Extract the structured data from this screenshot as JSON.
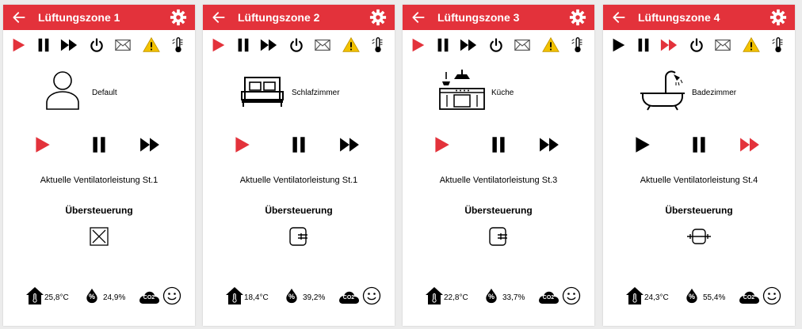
{
  "colors": {
    "accent": "#e3323b",
    "active": "#e3323b",
    "inactive": "#000000",
    "warning": "#f2c200"
  },
  "override_heading": "Übersteuerung",
  "panels": [
    {
      "title": "Lüftungszone 1",
      "room": "Default",
      "room_icon": "person-icon",
      "status": "Aktuelle Ventilatorleistung St.1",
      "active_mode": "play",
      "override_icon": "disabled-icon",
      "temperature": "25,8°C",
      "humidity": "24,9%"
    },
    {
      "title": "Lüftungszone 2",
      "room": "Schlafzimmer",
      "room_icon": "bed-icon",
      "status": "Aktuelle Ventilatorleistung St.1",
      "active_mode": "play",
      "override_icon": "fan-in-icon",
      "temperature": "18,4°C",
      "humidity": "39,2%"
    },
    {
      "title": "Lüftungszone 3",
      "room": "Küche",
      "room_icon": "kitchen-icon",
      "status": "Aktuelle Ventilatorleistung St.3",
      "active_mode": "play",
      "override_icon": "fan-in-icon",
      "temperature": "22,8°C",
      "humidity": "33,7%"
    },
    {
      "title": "Lüftungszone 4",
      "room": "Badezimmer",
      "room_icon": "bathtub-icon",
      "status": "Aktuelle Ventilatorleistung St.4",
      "active_mode": "fast-forward",
      "override_icon": "fan-through-icon",
      "temperature": "24,3°C",
      "humidity": "55,4%"
    }
  ],
  "sensors": {
    "co2_label": "CO2",
    "humidity_label": "%"
  }
}
